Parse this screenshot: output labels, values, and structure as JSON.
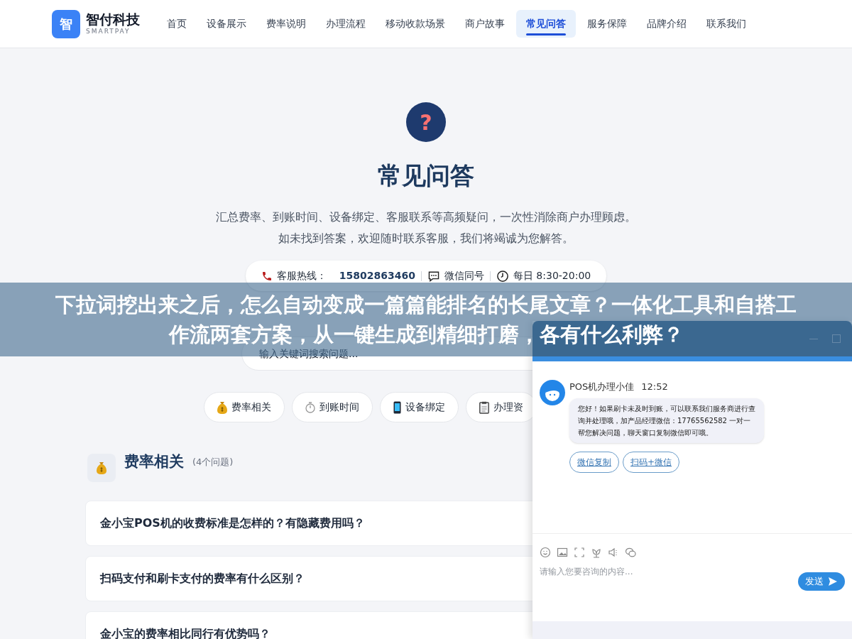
{
  "brand": {
    "logo_char": "智",
    "name": "智付科技",
    "tagline": "SMARTPAY"
  },
  "nav": [
    {
      "label": "首页",
      "selected": false
    },
    {
      "label": "设备展示",
      "selected": false
    },
    {
      "label": "费率说明",
      "selected": false
    },
    {
      "label": "办理流程",
      "selected": false
    },
    {
      "label": "移动收款场景",
      "selected": false
    },
    {
      "label": "商户故事",
      "selected": false
    },
    {
      "label": "常见问答",
      "selected": true
    },
    {
      "label": "服务保障",
      "selected": false
    },
    {
      "label": "品牌介绍",
      "selected": false
    },
    {
      "label": "联系我们",
      "selected": false
    }
  ],
  "hero": {
    "icon": "?",
    "title": "常见问答",
    "description": "汇总费率、到账时间、设备绑定、客服联系等高频疑问，一次性消除商户办理顾虑。如未找到答案，欢迎随时联系客服，我们将竭诚为您解答。",
    "contacts": [
      {
        "kind": "phone",
        "label": "客服热线：",
        "value": "15802863460"
      },
      {
        "kind": "wechat",
        "label": "微信同号"
      },
      {
        "kind": "clock",
        "label": "每日 8:30-20:00"
      }
    ]
  },
  "search": {
    "placeholder": "输入关键词搜索问题..."
  },
  "categories": [
    {
      "kind": "moneybag",
      "label": "费率相关"
    },
    {
      "kind": "stopwatch",
      "label": "到账时间"
    },
    {
      "kind": "phone",
      "label": "设备绑定"
    },
    {
      "kind": "clipboard",
      "label": "办理资"
    }
  ],
  "section": {
    "title": "费率相关",
    "count": "(4个问题)",
    "questions": [
      "金小宝POS机的收费标准是怎样的？有隐藏费用吗？",
      "扫码支付和刷卡支付的费率有什么区别？",
      "金小宝的费率相比同行有优势吗？"
    ]
  },
  "chat": {
    "sender": "POS机办理小佳",
    "time": "12:52",
    "message": "您好！如果刷卡未及时到账，可以联系我们服务商进行查询并处理哦，加产品经理微信：17765562582 一对一帮您解决问题，聊天窗口复制微信即可哦。",
    "quick_replies": [
      "微信复制",
      "扫码+微信"
    ],
    "input_placeholder": "请输入您要咨询的内容...",
    "send_label": "发送"
  },
  "overlay_banner": {
    "text": "下拉词挖出来之后，怎么自动变成一篇篇能排名的长尾文章？一体化工具和自搭工作流两套方案，从一键生成到精细打磨，各有什么利弊？"
  }
}
